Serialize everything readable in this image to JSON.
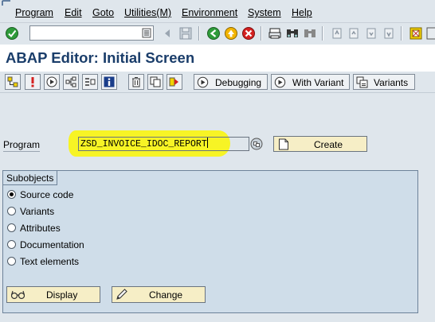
{
  "menu": {
    "items": [
      "Program",
      "Edit",
      "Goto",
      "Utilities(M)",
      "Environment",
      "System",
      "Help"
    ]
  },
  "command_field": {
    "value": ""
  },
  "title": "ABAP Editor: Initial Screen",
  "app_toolbar": {
    "debugging_label": "Debugging",
    "with_variant_label": "With Variant",
    "variants_label": "Variants"
  },
  "program": {
    "label": "Program",
    "value": "ZSD_INVOICE_IDOC_REPORT",
    "create_label": "Create",
    "highlight_color": "#f7f425"
  },
  "subobjects": {
    "title": "Subobjects",
    "options": [
      {
        "label": "Source code",
        "selected": true
      },
      {
        "label": "Variants",
        "selected": false
      },
      {
        "label": "Attributes",
        "selected": false
      },
      {
        "label": "Documentation",
        "selected": false
      },
      {
        "label": "Text elements",
        "selected": false
      }
    ],
    "display_label": "Display",
    "change_label": "Change"
  },
  "colors": {
    "title": "#1a3d6a",
    "background": "#dfe6ec",
    "group_background": "#cfdde9",
    "button_yellow": "#f6eec6"
  }
}
